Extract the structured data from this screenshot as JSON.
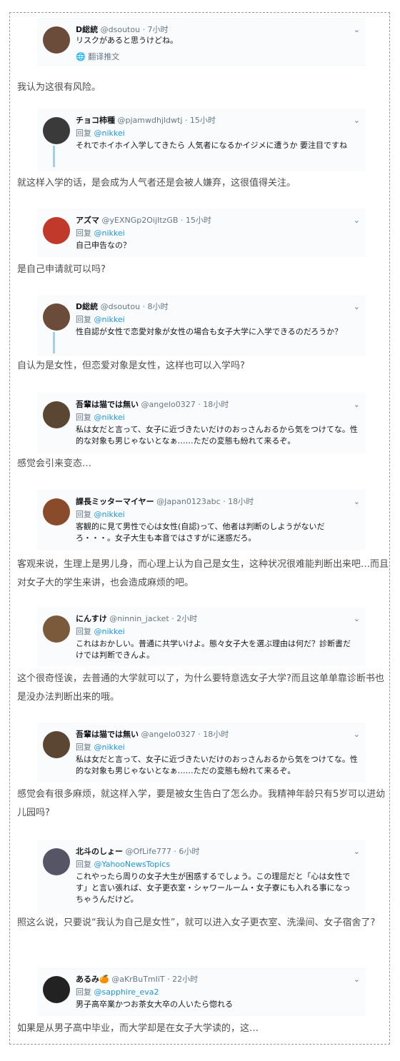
{
  "tweets": [
    {
      "name": "D総統",
      "handle": "@dsoutou · 7小时",
      "reply_prefix": "",
      "reply_to": "",
      "body": "リスクがあると思うけどね。",
      "translate": "翻译推文",
      "avatar_color": "#6b4c3b"
    },
    {
      "name": "チョコ柿種",
      "handle": "@pjamwdhjldwtj · 15小时",
      "reply_prefix": "回复",
      "reply_to": "@nikkei",
      "body": "それでホイホイ入学してきたら 人気者になるかイジメに遭うか 要注目ですね",
      "avatar_color": "#3a3a3a"
    },
    {
      "name": "アズマ",
      "handle": "@yEXNGp2OijItzGB · 15小时",
      "reply_prefix": "回复",
      "reply_to": "@nikkei",
      "body": "自己申告なの？",
      "avatar_color": "#c0392b"
    },
    {
      "name": "D総統",
      "handle": "@dsoutou · 8小时",
      "reply_prefix": "回复",
      "reply_to": "@nikkei",
      "body": "性自認が女性で恋愛対象が女性の場合も女子大学に入学できるのだろうか？",
      "avatar_color": "#6b4c3b"
    },
    {
      "name": "吾輩は猫では無い",
      "handle": "@angelo0327 · 18小时",
      "reply_prefix": "回复",
      "reply_to": "@nikkei",
      "body": "私は女だと言って、女子に近づきたいだけのおっさんおるから気をつけてな。性的な対象も男じゃないとなぁ……ただの変態も紛れて来るぞ。",
      "avatar_color": "#5a4632"
    },
    {
      "name": "課長ミッターマイヤー",
      "handle": "@Japan0123abc · 18小时",
      "reply_prefix": "回复",
      "reply_to": "@nikkei",
      "body": "客観的に見て男性で心は女性(自認)って、他者は判断のしようがないだろ・・・。女子大生も本音ではさすがに迷惑だろ。",
      "avatar_color": "#8a4b2a"
    },
    {
      "name": "にんすけ",
      "handle": "@ninnin_jacket · 2小时",
      "reply_prefix": "回复",
      "reply_to": "@nikkei",
      "body": "これはおかしい。普通に共学いけよ。態々女子大を選ぶ理由は何だ？診断書だけでは判断できんよ。",
      "avatar_color": "#7a5a3a"
    },
    {
      "name": "吾輩は猫では無い",
      "handle": "@angelo0327 · 18小时",
      "reply_prefix": "回复",
      "reply_to": "@nikkei",
      "body": "私は女だと言って、女子に近づきたいだけのおっさんおるから気をつけてな。性的な対象も男じゃないとなぁ……ただの変態も紛れて来るぞ。",
      "avatar_color": "#5a4632"
    },
    {
      "name": "北斗のしょー",
      "handle": "@OfLife777 · 6小时",
      "reply_prefix": "回复",
      "reply_to": "@YahooNewsTopics",
      "body": "これやったら周りの女子大生が困惑するでしょう。この理屈だと「心は女性です」と言い張れば、女子更衣室・シャワールーム・女子寮にも入れる事になっちゃうんだけど。",
      "avatar_color": "#556"
    },
    {
      "name": "あるみ🍊",
      "handle": "@aKrBuTmIiT · 22小时",
      "reply_prefix": "回复",
      "reply_to": "@sapphire_eva2",
      "body": "男子高卒業かつお茶女大卒の人いたら惚れる",
      "avatar_color": "#222"
    }
  ],
  "translations": [
    "我认为这很有风险。",
    "就这样入学的话，是会成为人气者还是会被人嫌弃，这很值得关注。",
    "是自己申请就可以吗?",
    "自认为是女性，但恋爱对象是女性，这样也可以入学吗?",
    "感觉会引来变态…",
    "客观来说，生理上是男儿身，而心理上认为自己是女生，这种状况很难能判断出来吧…而且对女子大的学生来讲，也会造成麻烦的吧。",
    "这个很奇怪诶，去普通的大学就可以了，为什么要特意选女子大学?而且这单单靠诊断书也是没办法判断出来的哦。",
    "感觉会有很多麻烦，就这样入学，要是被女生告白了怎么办。我精神年龄只有5岁可以进幼儿园吗?",
    "照这么说，只要说“我认为自己是女性”，就可以进入女子更衣室、洗澡间、女子宿舍了?",
    "如果是从男子高中毕业，而大学却是在女子大学读的，这…"
  ]
}
